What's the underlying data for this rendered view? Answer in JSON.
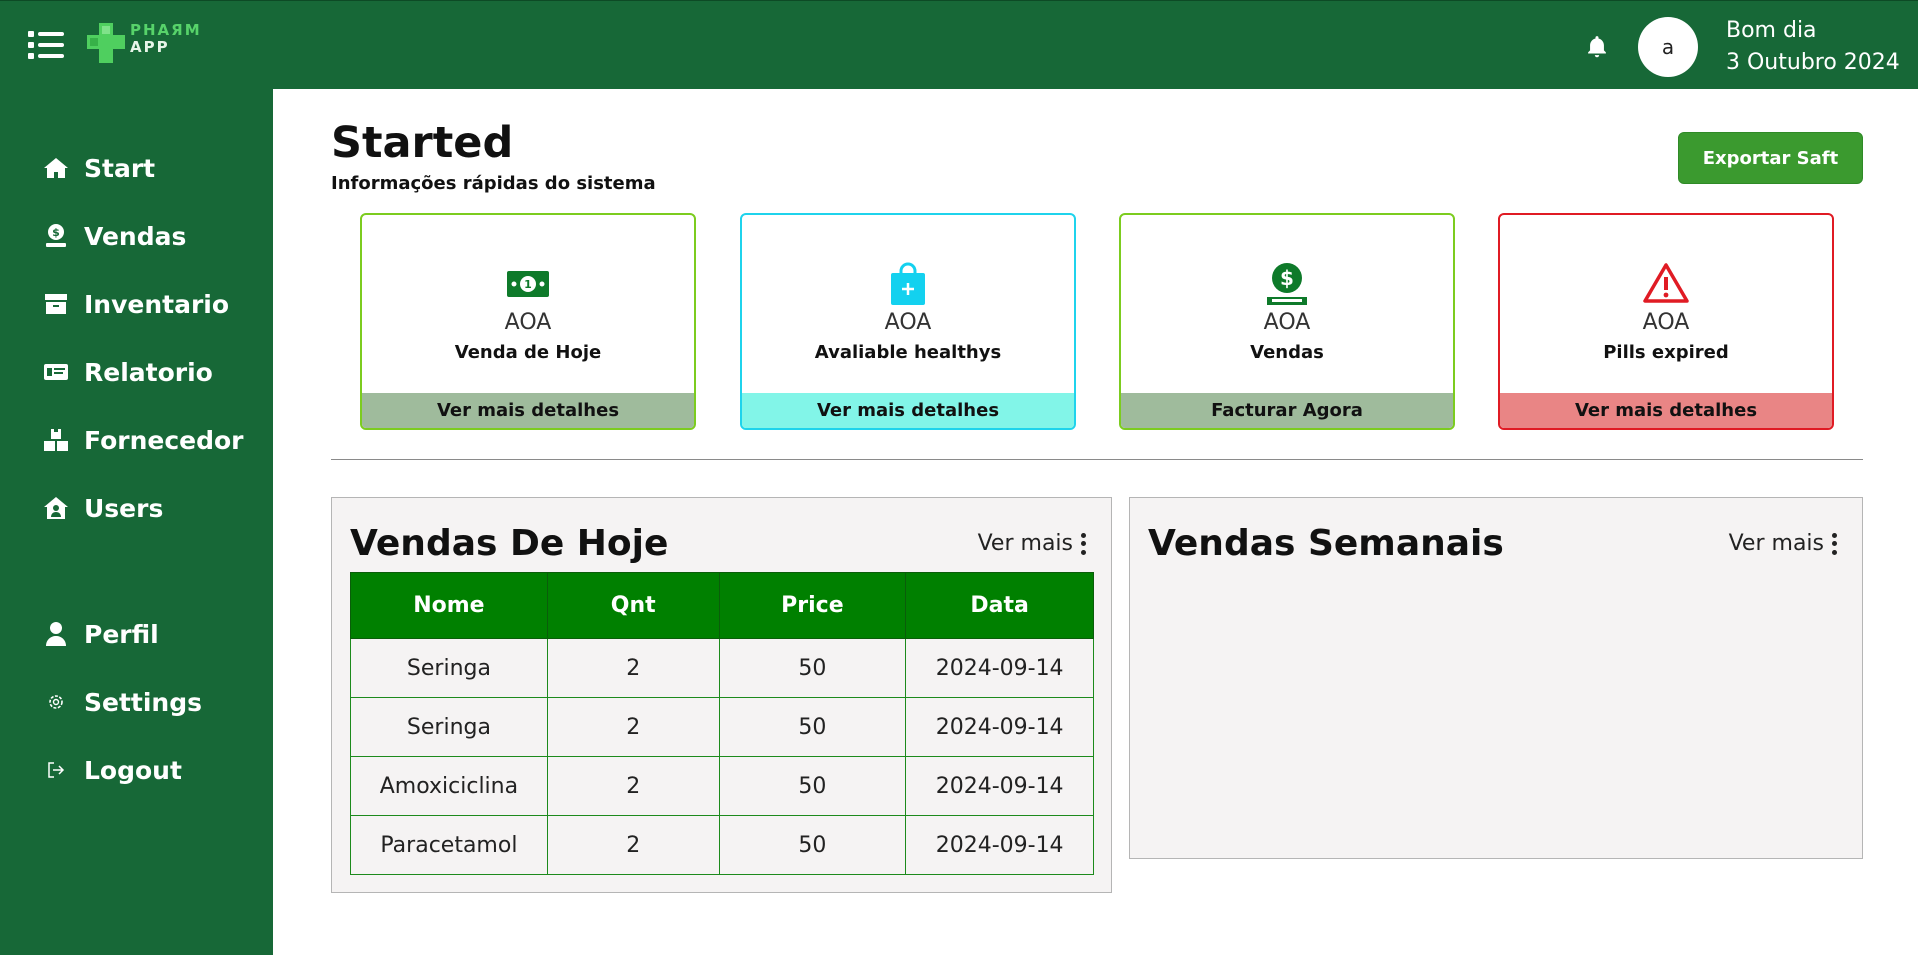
{
  "app": {
    "logo_line1": "PHAЯM",
    "logo_line2": "APP"
  },
  "header": {
    "greeting": "Bom dia",
    "date": "3 Outubro 2024",
    "avatar_initial": "a"
  },
  "sidebar": {
    "items": [
      {
        "label": "Start",
        "icon": "home-icon"
      },
      {
        "label": "Vendas",
        "icon": "sales-icon"
      },
      {
        "label": "Inventario",
        "icon": "archive-icon"
      },
      {
        "label": "Relatorio",
        "icon": "report-icon"
      },
      {
        "label": "Fornecedor",
        "icon": "boxes-icon"
      },
      {
        "label": "Users",
        "icon": "users-house-icon"
      },
      {
        "label": "Perfil",
        "icon": "user-icon"
      },
      {
        "label": "Settings",
        "icon": "gear-icon"
      },
      {
        "label": "Logout",
        "icon": "logout-icon"
      }
    ]
  },
  "main": {
    "title": "Started",
    "subtitle": "Informações rápidas do sistema",
    "export_label": "Exportar Saft",
    "cards": [
      {
        "currency": "AOA",
        "label": "Venda de Hoje",
        "footer": "Ver mais detalhes",
        "icon": "money-icon",
        "border": "#7ccc1f",
        "footer_bg": "#9fbb9c",
        "icon_color": "#0e7a2a"
      },
      {
        "currency": "AOA",
        "label": "Avaliable healthys",
        "footer": "Ver mais detalhes",
        "icon": "bag-plus-icon",
        "border": "#1fd3ec",
        "footer_bg": "#82f5e8",
        "icon_color": "#13d1ef"
      },
      {
        "currency": "AOA",
        "label": "Vendas",
        "footer": "Facturar Agora",
        "icon": "dollar-coin-icon",
        "border": "#7ccc1f",
        "footer_bg": "#9fbb9c",
        "icon_color": "#0e7a2a"
      },
      {
        "currency": "AOA",
        "label": "Pills expired",
        "footer": "Ver mais detalhes",
        "icon": "warning-icon",
        "border": "#e01b24",
        "footer_bg": "#e98585",
        "icon_color": "#e01b24"
      }
    ],
    "today_sales": {
      "title": "Vendas De Hoje",
      "more_label": "Ver mais",
      "columns": [
        "Nome",
        "Qnt",
        "Price",
        "Data"
      ],
      "rows": [
        [
          "Seringa",
          "2",
          "50",
          "2024-09-14"
        ],
        [
          "Seringa",
          "2",
          "50",
          "2024-09-14"
        ],
        [
          "Amoxiciclina",
          "2",
          "50",
          "2024-09-14"
        ],
        [
          "Paracetamol",
          "2",
          "50",
          "2024-09-14"
        ]
      ]
    },
    "weekly_sales": {
      "title": "Vendas Semanais",
      "more_label": "Ver mais"
    }
  }
}
